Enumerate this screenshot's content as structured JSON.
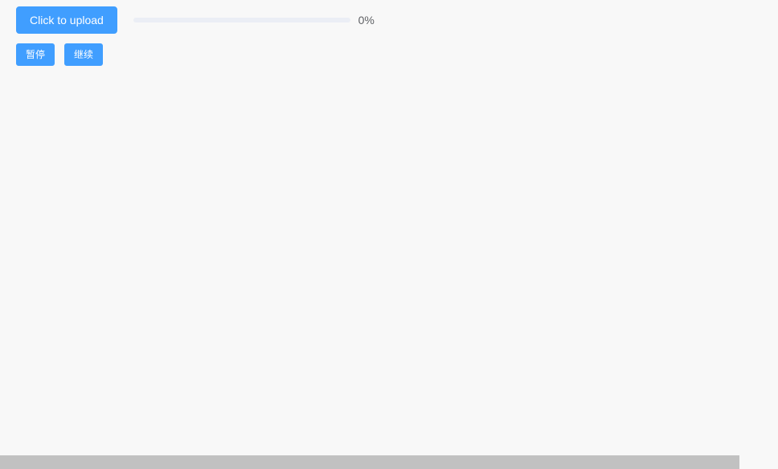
{
  "upload": {
    "button_label": "Click to upload",
    "progress_percent": "0%",
    "progress_value": 0
  },
  "controls": {
    "pause_label": "暂停",
    "resume_label": "继续"
  },
  "colors": {
    "primary": "#409eff",
    "background": "#f8f8f8",
    "progress_track": "#ebeef5",
    "text": "#606266",
    "scrollbar": "#c1c1c1"
  }
}
